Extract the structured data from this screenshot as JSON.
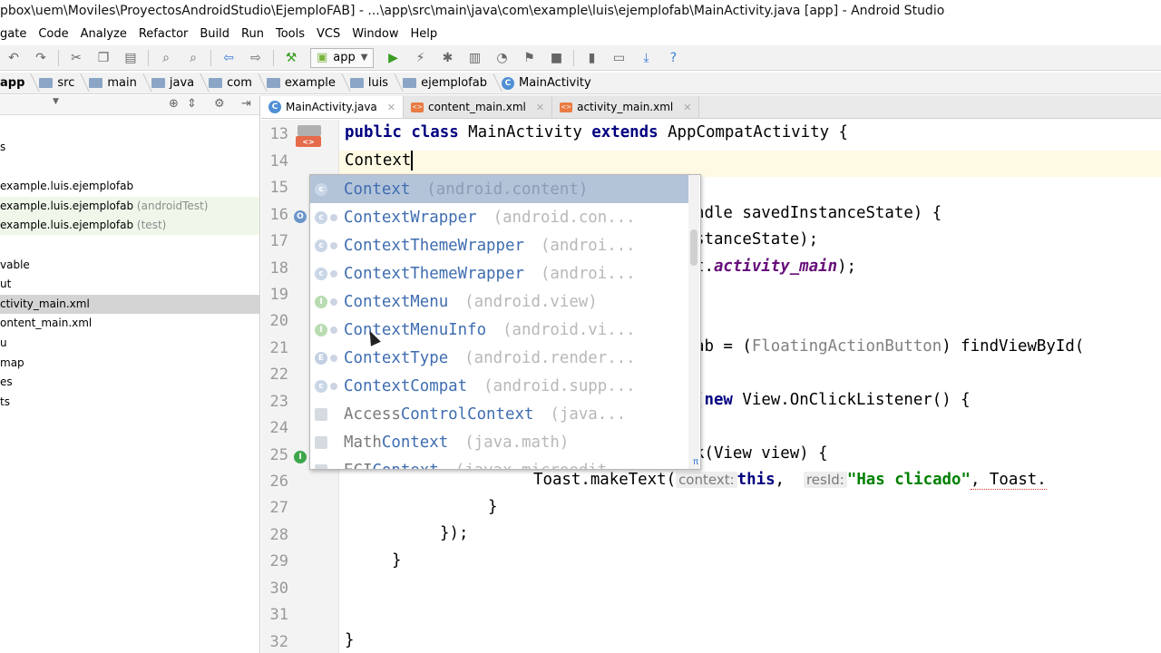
{
  "title": "pbox\\uem\\Moviles\\ProyectosAndroidStudio\\EjemploFAB] - ...\\app\\src\\main\\java\\com\\example\\luis\\ejemplofab\\MainActivity.java [app] - Android Studio",
  "menu": [
    "gate",
    "Code",
    "Analyze",
    "Refactor",
    "Build",
    "Run",
    "Tools",
    "VCS",
    "Window",
    "Help"
  ],
  "toolbar": {
    "run_config": "app"
  },
  "breadcrumb": [
    "app",
    "src",
    "main",
    "java",
    "com",
    "example",
    "luis",
    "ejemplofab",
    "MainActivity"
  ],
  "sidebar": {
    "items": [
      {
        "label": "s",
        "suffix": ""
      },
      {
        "label": "example.luis.ejemplofab",
        "suffix": ""
      },
      {
        "label": "example.luis.ejemplofab",
        "suffix": "(androidTest)"
      },
      {
        "label": "example.luis.ejemplofab",
        "suffix": "(test)"
      },
      {
        "label": "vable",
        "suffix": ""
      },
      {
        "label": "ut",
        "suffix": ""
      },
      {
        "label": "ctivity_main.xml",
        "suffix": ""
      },
      {
        "label": "ontent_main.xml",
        "suffix": ""
      },
      {
        "label": "u",
        "suffix": ""
      },
      {
        "label": "map",
        "suffix": ""
      },
      {
        "label": "es",
        "suffix": ""
      },
      {
        "label": "ts",
        "suffix": ""
      }
    ]
  },
  "tabs": [
    {
      "label": "MainActivity.java",
      "active": true
    },
    {
      "label": "content_main.xml",
      "active": false
    },
    {
      "label": "activity_main.xml",
      "active": false
    }
  ],
  "editor": {
    "line_numbers": [
      "13",
      "14",
      "15",
      "16",
      "17",
      "18",
      "19",
      "20",
      "21",
      "22",
      "23",
      "24",
      "25",
      "26",
      "27",
      "28",
      "29",
      "30",
      "31",
      "32"
    ],
    "line13": {
      "kw1": "public",
      "kw2": "class",
      "name": "MainActivity",
      "kw3": "extends",
      "rest": "AppCompatActivity {"
    },
    "line14": "Context",
    "line16": "ndle savedInstanceState) {",
    "line17": "stanceState);",
    "line18_a": "t.",
    "line18_b": "activity_main",
    "line18_c": ");",
    "line21_a": "ab = (",
    "line21_b": "FloatingActionButton",
    "line21_c": ") findViewById(",
    "line23_a": "(",
    "line23_kw": "new",
    "line23_b": " View.OnClickListener() {",
    "line25": "k(View view) {",
    "line26": {
      "call": "Toast.makeText(",
      "hint1": "context:",
      "this": "this",
      "hint2": "resId:",
      "str": "\"Has clicado\"",
      "rest": ", Toast."
    },
    "line27": "}",
    "line28": "});",
    "line29": "}",
    "line32": "}"
  },
  "completion": [
    {
      "icon": "c",
      "name": "Context",
      "pkg": "(android.content)",
      "selected": true
    },
    {
      "icon": "c",
      "name": "ContextWrapper",
      "pkg": "(android.con...",
      "selected": false
    },
    {
      "icon": "c",
      "name": "ContextThemeWrapper",
      "pkg": "(androi...",
      "selected": false
    },
    {
      "icon": "c",
      "name": "ContextThemeWrapper",
      "pkg": "(androi...",
      "selected": false
    },
    {
      "icon": "I",
      "name": "ContextMenu",
      "pkg": "(android.view)",
      "selected": false
    },
    {
      "icon": "I",
      "name": "ContextMenuInfo",
      "pkg": "(android.vi...",
      "selected": false
    },
    {
      "icon": "E",
      "name": "ContextType",
      "pkg": "(android.render...",
      "selected": false
    },
    {
      "icon": "c",
      "name": "ContextCompat",
      "pkg": "(android.supp...",
      "selected": false
    },
    {
      "icon": "sq",
      "name_pre": "Access",
      "name_ctl": "ControlContext",
      "pkg": "(java...",
      "selected": false
    },
    {
      "icon": "sq",
      "name_pre": "Math",
      "name_ctl": "Context",
      "pkg": "(java.math)",
      "selected": false
    },
    {
      "icon": "sq",
      "name_pre": "ECI",
      "name_ctl": "Context",
      "pkg": "(javax.microedit...",
      "selected": false
    }
  ],
  "colors": {
    "keyword": "#000080",
    "string": "#008000",
    "completion_name": "#3f6db0",
    "selection": "#b3c4d9",
    "caret_line": "#fffae3"
  }
}
